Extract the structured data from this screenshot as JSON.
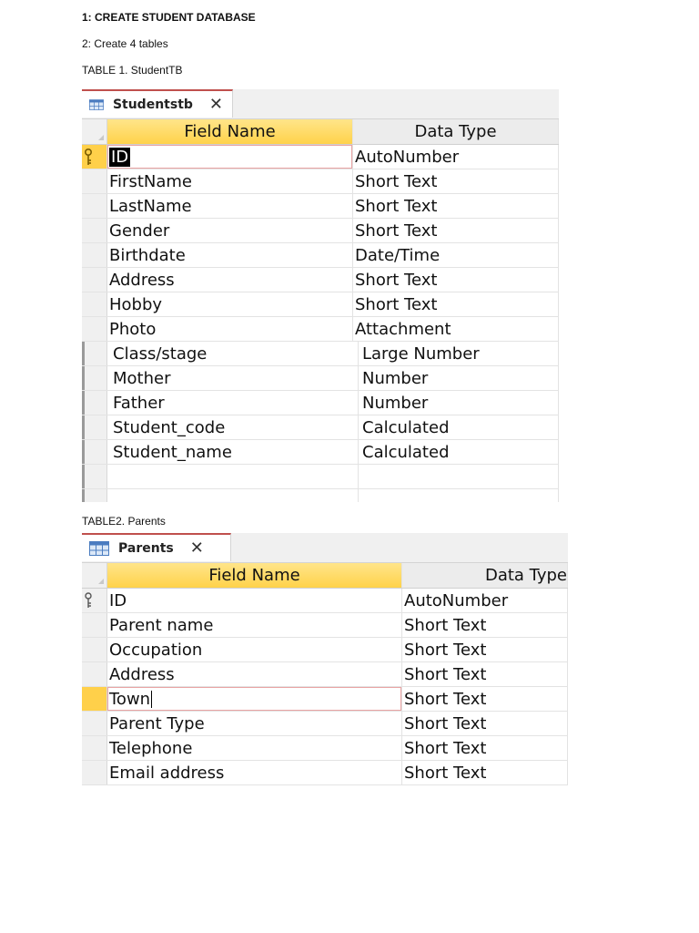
{
  "doc": {
    "line1": "1: CREATE STUDENT DATABASE",
    "line2": "2: Create 4 tables",
    "line3": "TABLE 1. StudentTB",
    "line4": "TABLE2.  Parents"
  },
  "table1": {
    "tab_label": "Studentstb",
    "columns": {
      "field": "Field Name",
      "type": "Data Type"
    },
    "rows": [
      {
        "field": "ID",
        "type": "AutoNumber"
      },
      {
        "field": "FirstName",
        "type": "Short Text"
      },
      {
        "field": "LastName",
        "type": "Short Text"
      },
      {
        "field": "Gender",
        "type": "Short Text"
      },
      {
        "field": "Birthdate",
        "type": "Date/Time"
      },
      {
        "field": "Address",
        "type": "Short Text"
      },
      {
        "field": "Hobby",
        "type": "Short Text"
      },
      {
        "field": "Photo",
        "type": "Attachment"
      },
      {
        "field": "Class/stage",
        "type": "Large Number"
      },
      {
        "field": "Mother",
        "type": "Number"
      },
      {
        "field": "Father",
        "type": "Number"
      },
      {
        "field": "Student_code",
        "type": "Calculated"
      },
      {
        "field": "Student_name",
        "type": "Calculated"
      }
    ]
  },
  "table2": {
    "tab_label": "Parents",
    "columns": {
      "field": "Field Name",
      "type": "Data Type"
    },
    "rows": [
      {
        "field": "ID",
        "type": "AutoNumber"
      },
      {
        "field": "Parent name",
        "type": "Short Text"
      },
      {
        "field": "Occupation",
        "type": "Short Text"
      },
      {
        "field": "Address",
        "type": "Short Text"
      },
      {
        "field": "Town",
        "type": "Short Text"
      },
      {
        "field": "Parent Type",
        "type": "Short Text"
      },
      {
        "field": "Telephone",
        "type": "Short Text"
      },
      {
        "field": "Email address",
        "type": "Short Text"
      }
    ]
  },
  "colors": {
    "header_gold": "#ffd24a",
    "tab_accent": "#c0504d",
    "selector_active": "#ffd04a"
  },
  "icons": {
    "table_tab": "table-icon",
    "close": "close-icon",
    "primary_key": "key-icon"
  }
}
